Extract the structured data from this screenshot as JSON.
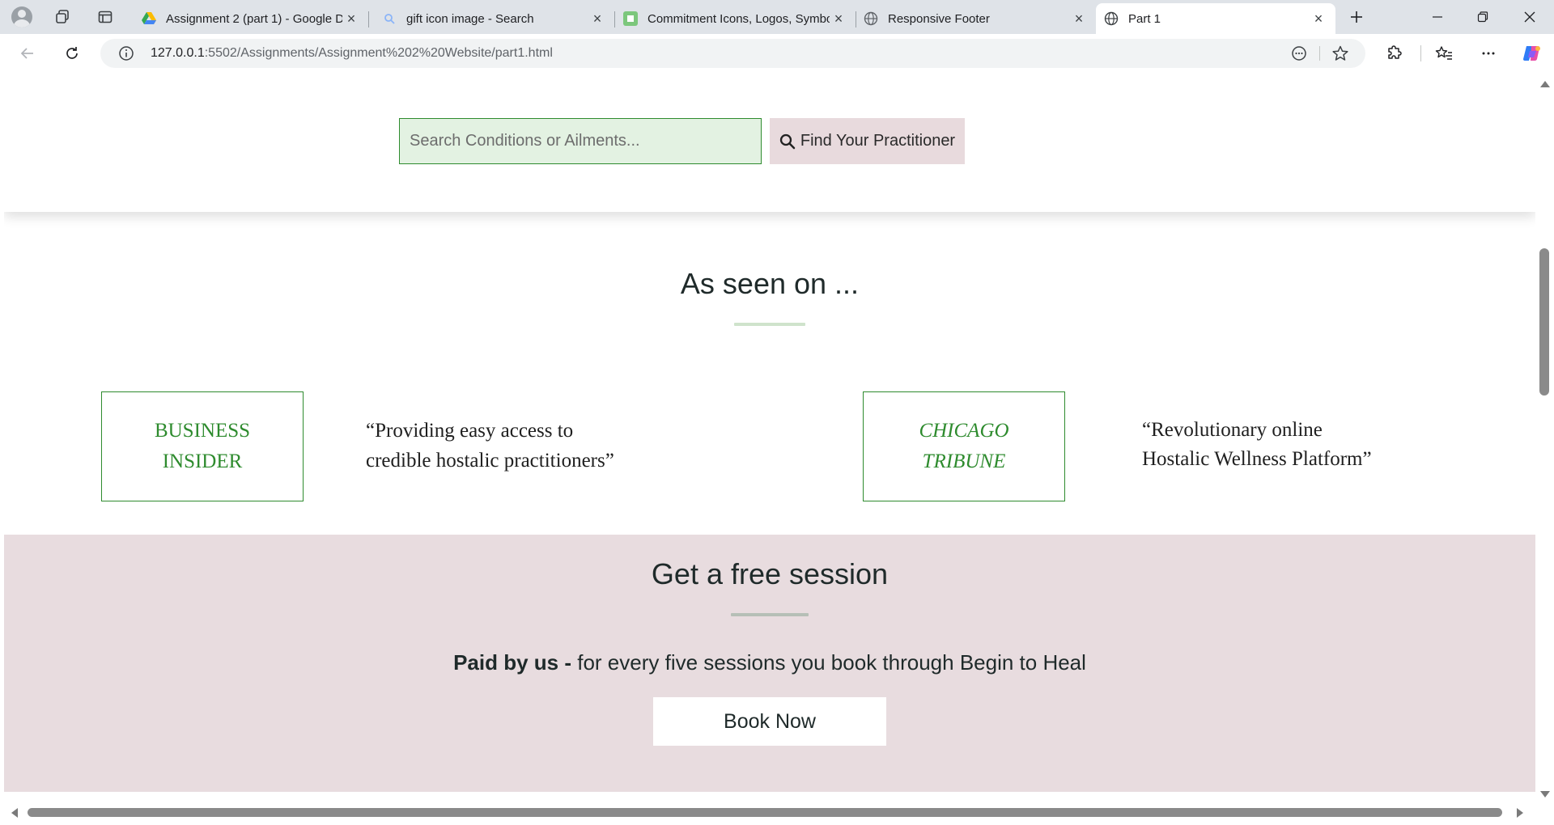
{
  "browser": {
    "tabs": [
      {
        "title": "Assignment 2 (part 1) - Google Dr",
        "icon": "google-drive-icon",
        "active": false
      },
      {
        "title": "gift icon image - Search",
        "icon": "search-icon",
        "active": false
      },
      {
        "title": "Commitment Icons, Logos, Symbo",
        "icon": "site-favicon",
        "active": false
      },
      {
        "title": "Responsive Footer",
        "icon": "globe-icon",
        "active": false
      },
      {
        "title": "Part 1",
        "icon": "globe-icon",
        "active": true
      }
    ],
    "url_host": "127.0.0.1",
    "url_path": ":5502/Assignments/Assignment%202%20Website/part1.html"
  },
  "search": {
    "placeholder": "Search Conditions or Ailments...",
    "button_label": "Find Your Practitioner"
  },
  "seen_on": {
    "title": "As seen on ...",
    "items": [
      {
        "logo_line1": "BUSINESS",
        "logo_line2": "INSIDER",
        "italic": false,
        "quote_line1": "“Providing easy access to",
        "quote_line2": "credible hostalic practitioners”"
      },
      {
        "logo_line1": "CHICAGO",
        "logo_line2": "TRIBUNE",
        "italic": true,
        "quote_line1": "“Revolutionary online",
        "quote_line2": "Hostalic Wellness Platform”"
      }
    ]
  },
  "free_session": {
    "title": "Get a free session",
    "bold_text": "Paid by us - ",
    "text": "for every five sessions you book through Begin to Heal",
    "button_label": "Book Now"
  },
  "colors": {
    "accent_green": "#2e8b2e",
    "search_bg": "#e3f2e2",
    "button_pink": "#e8dadd",
    "section_pink": "#e8dcdf"
  }
}
